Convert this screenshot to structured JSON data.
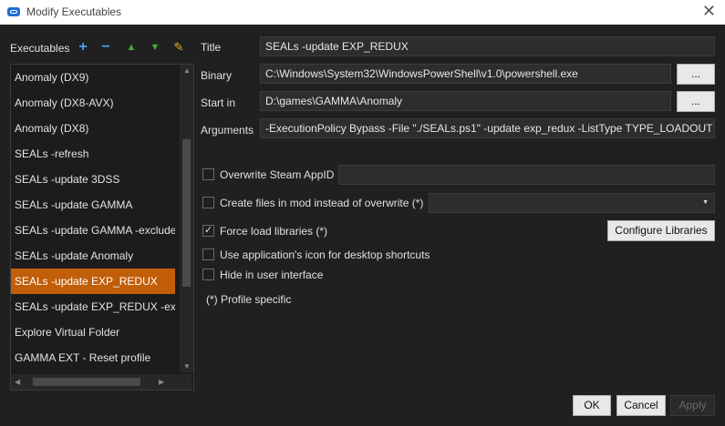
{
  "window": {
    "title": "Modify Executables",
    "close": "✕"
  },
  "sidebar": {
    "label": "Executables",
    "toolbar": {
      "add": "+",
      "remove": "−",
      "up": "▲",
      "down": "▼",
      "clean": "✎"
    },
    "items": [
      {
        "label": "Anomaly (DX9)"
      },
      {
        "label": "Anomaly (DX8-AVX)"
      },
      {
        "label": "Anomaly (DX8)"
      },
      {
        "label": "SEALs -refresh"
      },
      {
        "label": "SEALs -update 3DSS"
      },
      {
        "label": "SEALs -update GAMMA"
      },
      {
        "label": "SEALs -update GAMMA -exclude"
      },
      {
        "label": "SEALs -update Anomaly"
      },
      {
        "label": "SEALs -update EXP_REDUX"
      },
      {
        "label": "SEALs -update EXP_REDUX -exclu"
      },
      {
        "label": "Explore Virtual Folder"
      },
      {
        "label": "GAMMA EXT - Reset profile"
      }
    ],
    "selected_index": 8
  },
  "form": {
    "title_label": "Title",
    "title_value": "SEALs -update EXP_REDUX",
    "binary_label": "Binary",
    "binary_value": "C:\\Windows\\System32\\WindowsPowerShell\\v1.0\\powershell.exe",
    "start_label": "Start in",
    "start_value": "D:\\games\\GAMMA\\Anomaly",
    "browse": "...",
    "arguments_label": "Arguments",
    "arguments_value": "-ExecutionPolicy Bypass -File \"./SEALs.ps1\" -update exp_redux -ListType TYPE_LOADOUT"
  },
  "options": {
    "steam_appid": {
      "label": "Overwrite Steam AppID",
      "checked": false,
      "value": ""
    },
    "create_files": {
      "label": "Create files in mod instead of overwrite (*)",
      "checked": false,
      "value": ""
    },
    "force_load": {
      "label": "Force load libraries (*)",
      "checked": true
    },
    "configure_libraries": "Configure Libraries",
    "app_icon": {
      "label": "Use application's icon for desktop shortcuts",
      "checked": false
    },
    "hide_ui": {
      "label": "Hide in user interface",
      "checked": false
    },
    "note": "(*) Profile specific"
  },
  "buttons": {
    "ok": "OK",
    "cancel": "Cancel",
    "apply": "Apply"
  },
  "colors": {
    "selection": "#c15e0a",
    "add_icon": "#4aa0f0",
    "remove_icon": "#4aa0f0",
    "arrow_icon": "#3fae2a",
    "clean_icon": "#e0b020"
  }
}
